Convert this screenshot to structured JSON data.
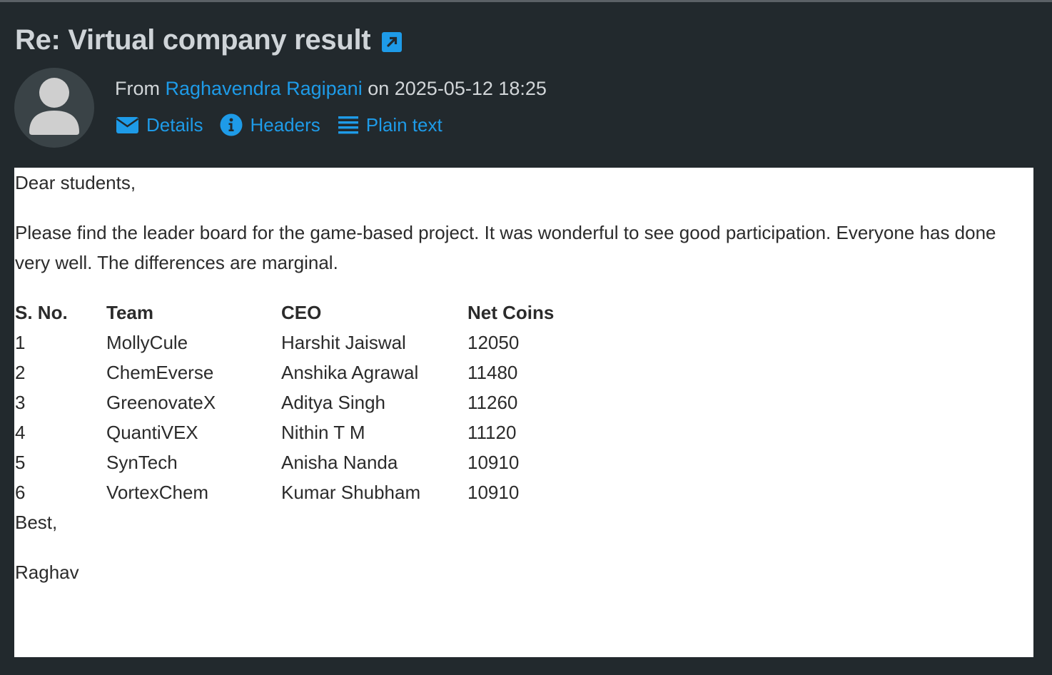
{
  "message": {
    "subject": "Re: Virtual company result",
    "from_prefix": "From ",
    "sender_name": "Raghavendra Ragipani",
    "date_prefix": " on ",
    "date": "2025-05-12 18:25"
  },
  "actions": {
    "details": "Details",
    "headers": "Headers",
    "plain_text": "Plain text"
  },
  "body": {
    "greeting": "Dear students,",
    "paragraph": "Please find the leader board for the game-based project. It was wonderful to see good participation. Everyone has done very well. The differences are marginal.",
    "table": {
      "headers": [
        "S. No.",
        "Team",
        "CEO",
        "Net Coins"
      ],
      "rows": [
        [
          "1",
          "MollyCule",
          "Harshit Jaiswal",
          "12050"
        ],
        [
          "2",
          "ChemEverse",
          "Anshika Agrawal",
          "11480"
        ],
        [
          "3",
          "GreenovateX",
          "Aditya Singh",
          "11260"
        ],
        [
          "4",
          "QuantiVEX",
          "Nithin T M",
          "11120"
        ],
        [
          "5",
          "SynTech",
          "Anisha Nanda",
          "10910"
        ],
        [
          "6",
          "VortexChem",
          "Kumar Shubham",
          "10910"
        ]
      ]
    },
    "closing": "Best,",
    "signature": "Raghav"
  },
  "icons": {
    "open_external": "external-link-icon",
    "avatar": "user-avatar-icon",
    "details": "envelope-icon",
    "headers": "info-icon",
    "plain_text": "list-icon"
  },
  "colors": {
    "background": "#22292d",
    "link": "#1e9be8",
    "title": "#cfd4d8",
    "content_bg": "#ffffff"
  }
}
